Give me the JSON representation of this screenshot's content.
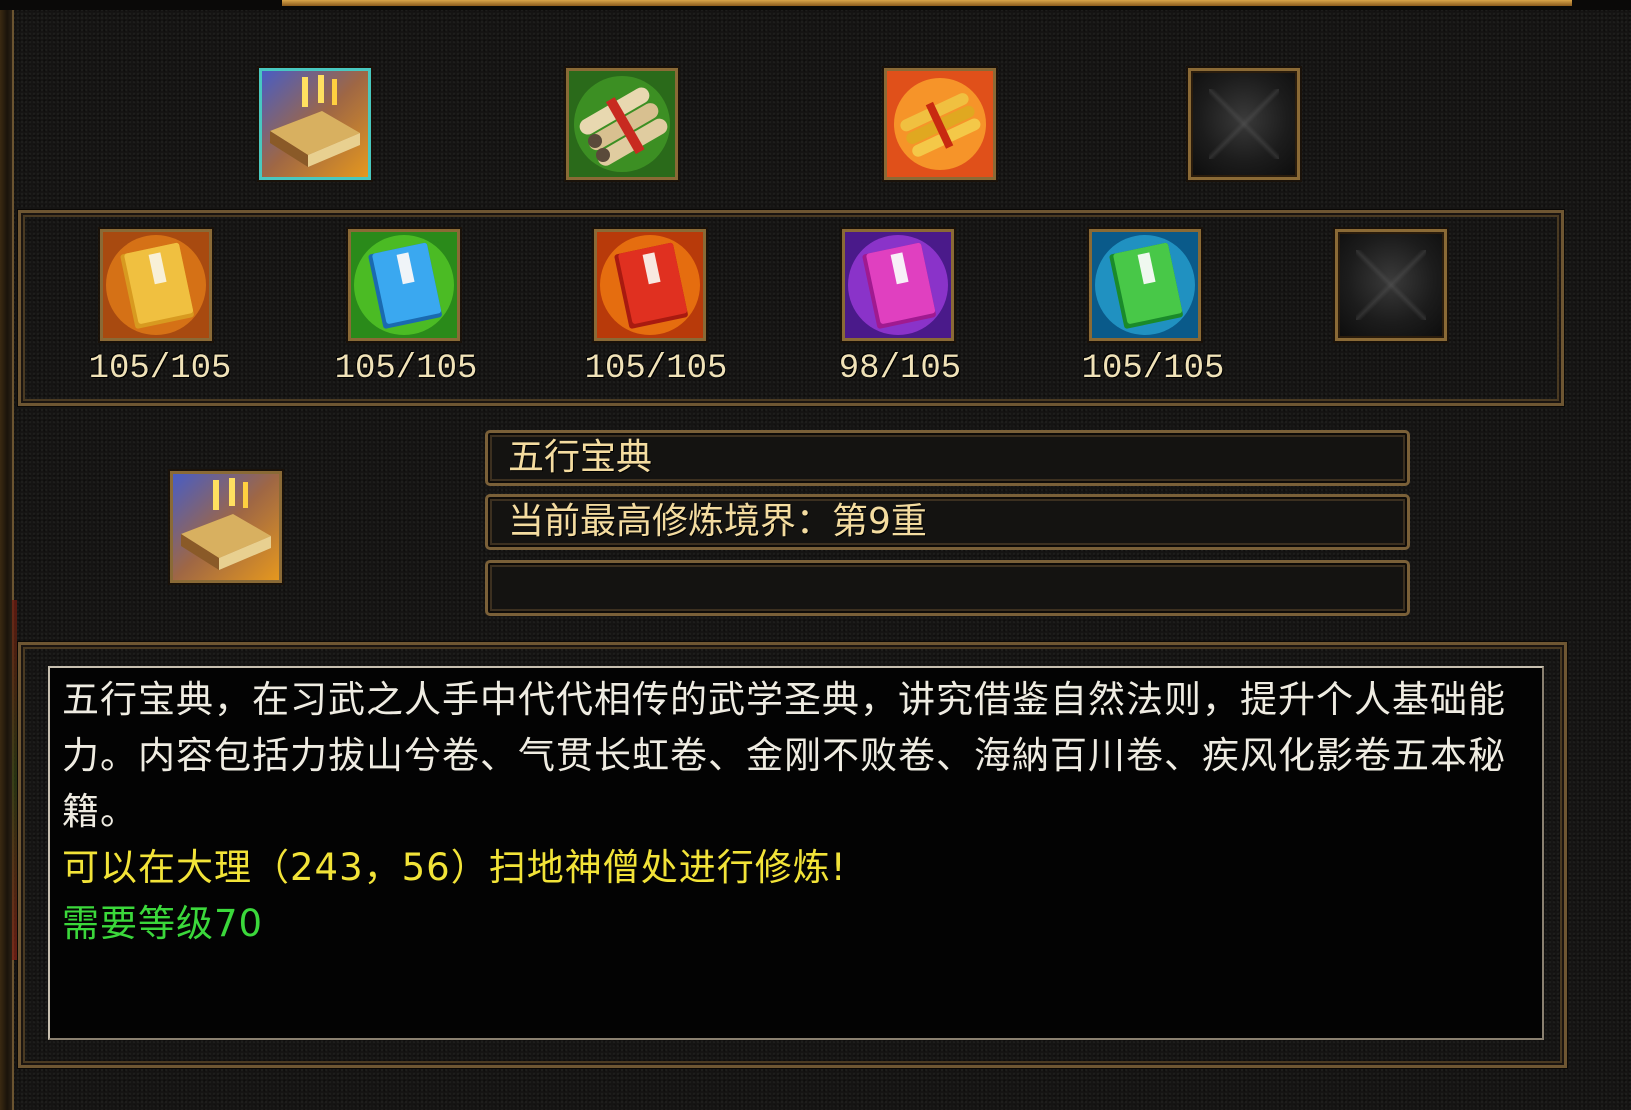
{
  "top_row": [
    {
      "icon": "five-elements-tome-icon",
      "selected": true
    },
    {
      "icon": "scroll-bundle-icon",
      "selected": false
    },
    {
      "icon": "golden-scrolls-icon",
      "selected": false
    },
    {
      "icon": "empty-slot-icon",
      "selected": false
    }
  ],
  "books": [
    {
      "icon": "yellow-manual-icon",
      "color": "#e0a020",
      "count": "105/105"
    },
    {
      "icon": "blue-manual-icon",
      "color": "#2a8fe0",
      "count": "105/105"
    },
    {
      "icon": "red-manual-icon",
      "color": "#d82a18",
      "count": "105/105"
    },
    {
      "icon": "purple-manual-icon",
      "color": "#c02ac0",
      "count": "98/105"
    },
    {
      "icon": "green-manual-icon",
      "color": "#38b83a",
      "count": "105/105"
    },
    {
      "icon": "empty-slot-icon",
      "color": "#1c1c1c",
      "count": ""
    }
  ],
  "info": {
    "icon": "five-elements-tome-icon",
    "name": "五行宝典",
    "realm": "当前最高修炼境界：第9重",
    "extra": ""
  },
  "description": {
    "text": "五行宝典，在习武之人手中代代相传的武学圣典，讲究借鉴自然法则，提升个人基础能力。内容包括力拔山兮卷、气贯长虹卷、金刚不败卷、海納百川卷、疾风化影卷五本秘籍。",
    "location": "可以在大理（243，56）扫地神僧处进行修炼!",
    "requirement": "需要等级70",
    "colors": {
      "text": "#efece2",
      "location": "#f2e338",
      "requirement": "#3bd83b"
    }
  }
}
